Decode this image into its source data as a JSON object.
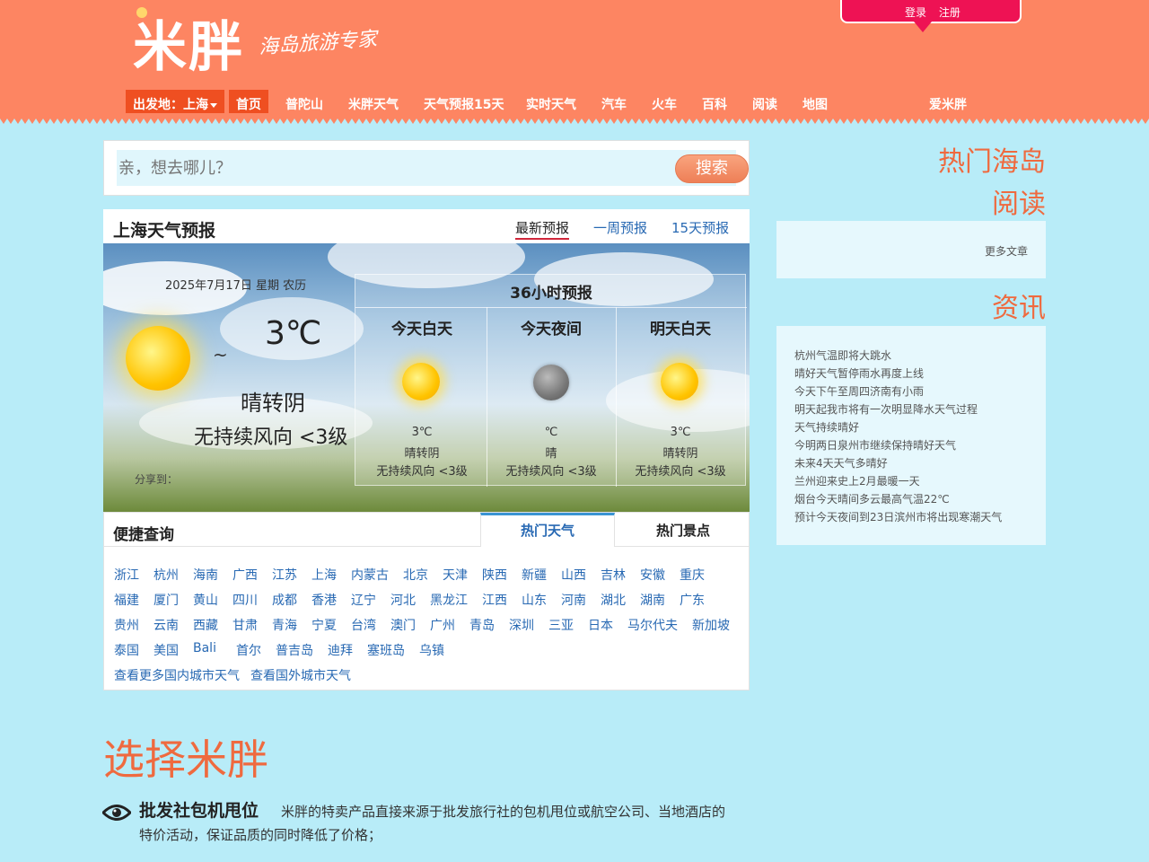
{
  "header": {
    "logo": "米胖",
    "tagline": "海岛旅游专家",
    "login": "登录",
    "register": "注册"
  },
  "nav": {
    "depart": "出发地：上海",
    "items": [
      "首页",
      "普陀山",
      "米胖天气",
      "天气预报15天",
      "实时天气",
      "汽车",
      "火车",
      "百科",
      "阅读",
      "地图"
    ],
    "love": "爱米胖"
  },
  "search": {
    "placeholder": "亲，想去哪儿？",
    "button": "搜索"
  },
  "weather": {
    "title": "上海天气预报",
    "tabs": [
      "最新预报",
      "一周预报",
      "15天预报"
    ],
    "date": "2025年7月17日 星期 农历",
    "tilde": "~",
    "temp": "3℃",
    "condition": "晴转阴",
    "wind": "无持续风向 <3级",
    "share": "分享到：",
    "forecast_title": "36小时预报",
    "forecast": [
      {
        "title": "今天白天",
        "icon": "sun-icon",
        "temp": "3℃",
        "cond": "晴转阴",
        "wind": "无持续风向 <3级"
      },
      {
        "title": "今天夜间",
        "icon": "moon-icon",
        "temp": "℃",
        "cond": "晴",
        "wind": "无持续风向 <3级"
      },
      {
        "title": "明天白天",
        "icon": "sun-icon",
        "temp": "3℃",
        "cond": "晴转阴",
        "wind": "无持续风向 <3级"
      }
    ]
  },
  "quick": {
    "title": "便捷查询",
    "tabs": [
      "热门天气",
      "热门景点"
    ],
    "rows": [
      [
        "浙江",
        "杭州",
        "海南",
        "广西",
        "江苏",
        "上海",
        "内蒙古",
        "北京",
        "天津",
        "陕西",
        "新疆",
        "山西",
        "吉林",
        "安徽",
        "重庆"
      ],
      [
        "福建",
        "厦门",
        "黄山",
        "四川",
        "成都",
        "香港",
        "辽宁",
        "河北",
        "黑龙江",
        "江西",
        "山东",
        "河南",
        "湖北",
        "湖南",
        "广东"
      ],
      [
        "贵州",
        "云南",
        "西藏",
        "甘肃",
        "青海",
        "宁夏",
        "台湾",
        "澳门",
        "广州",
        "青岛",
        "深圳",
        "三亚",
        "日本",
        "马尔代夫",
        "新加坡"
      ],
      [
        "泰国",
        "美国",
        "Bali",
        "首尔",
        "普吉岛",
        "迪拜",
        "塞班岛",
        "乌镇"
      ],
      [
        "查看更多国内城市天气",
        "查看国外城市天气"
      ]
    ]
  },
  "choose": {
    "title": "选择米胖",
    "feature_title": "批发社包机甩位",
    "feature_text": "米胖的特卖产品直接来源于批发旅行社的包机甩位或航空公司、当地酒店的特价活动，保证品质的同时降低了价格；"
  },
  "right": {
    "islands_title_1": "热门海岛",
    "islands_title_2": "阅读",
    "more_articles": "更多文章",
    "news_title": "资讯",
    "news": [
      "杭州气温即将大跳水",
      "晴好天气暂停雨水再度上线",
      "今天下午至周四济南有小雨",
      "明天起我市将有一次明显降水天气过程",
      "天气持续晴好",
      "今明两日泉州市继续保持晴好天气",
      "未来4天天气多晴好",
      "兰州迎来史上2月最暖一天",
      "烟台今天晴间多云最高气温22℃",
      "预计今天夜间到23日滨州市将出现寒潮天气"
    ]
  },
  "colors": {
    "header": "#fd8562",
    "accent": "#ef6a3f",
    "link": "#2869b3",
    "background": "#b8ecf8",
    "login": "#ee1254"
  }
}
